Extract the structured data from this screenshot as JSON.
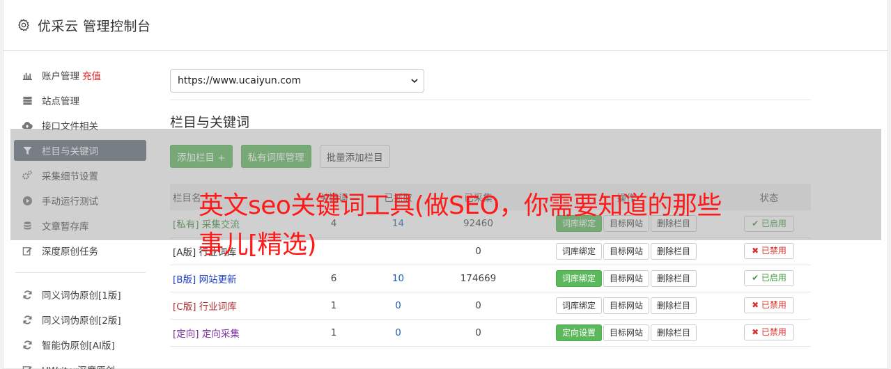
{
  "header": {
    "title": "优采云 管理控制台"
  },
  "sidebar": {
    "items": [
      {
        "label": "账户管理",
        "extra": "充值",
        "icon": "bar-chart-icon"
      },
      {
        "label": "站点管理",
        "icon": "server-icon"
      },
      {
        "label": "接口文件相关",
        "icon": "cloud-upload-icon"
      },
      {
        "label": "栏目与关键词",
        "icon": "filter-icon",
        "active": true
      },
      {
        "label": "采集细节设置",
        "icon": "gears-icon"
      },
      {
        "label": "手动运行测试",
        "icon": "play-icon"
      },
      {
        "label": "文章暂存库",
        "icon": "database-icon"
      },
      {
        "label": "深度原创任务",
        "icon": "edit-icon"
      }
    ],
    "items2": [
      {
        "label": "同义词伪原创[1版]",
        "icon": "refresh-icon"
      },
      {
        "label": "同义词伪原创[2版]",
        "icon": "refresh-icon"
      },
      {
        "label": "智能伪原创[AI版]",
        "icon": "refresh-icon"
      },
      {
        "label": "UWriter深度原创",
        "icon": "edit-icon"
      }
    ]
  },
  "main": {
    "site_select": "https://www.ucaiyun.com",
    "section_title": "栏目与关键词",
    "buttons": {
      "add_column": "添加栏目 +",
      "private_lib": "私有词库管理",
      "batch_add": "批量添加栏目"
    },
    "table": {
      "headers": [
        "栏目名",
        "关键词",
        "已抓取",
        "已采集",
        "操作",
        "状态"
      ],
      "header_col1_visible": "栏目名",
      "rows": [
        {
          "tag": "[私有]",
          "name": "采集交流",
          "color": "#3c8a3c",
          "keywords": "4",
          "fetched": "14",
          "collected": "92460",
          "op1": "词库绑定",
          "op1_green": true,
          "op2": "目标网站",
          "op3": "删除栏目",
          "status": "已启用",
          "on": true
        },
        {
          "tag": "[A版]",
          "name": "行业词库",
          "color": "#333333",
          "keywords": "",
          "fetched": "",
          "collected": "0",
          "op1": "词库绑定",
          "op1_green": false,
          "op2": "目标网站",
          "op3": "删除栏目",
          "status": "已禁用",
          "on": false
        },
        {
          "tag": "[B版]",
          "name": "网站更新",
          "color": "#1f3fc8",
          "keywords": "6",
          "fetched": "10",
          "collected": "174669",
          "op1": "词库绑定",
          "op1_green": true,
          "op2": "目标网站",
          "op3": "删除栏目",
          "status": "已启用",
          "on": true
        },
        {
          "tag": "[C版]",
          "name": "行业词库",
          "color": "#b03030",
          "keywords": "1",
          "fetched": "0",
          "collected": "0",
          "op1": "词库绑定",
          "op1_green": false,
          "op2": "目标网站",
          "op3": "删除栏目",
          "status": "已禁用",
          "on": false
        },
        {
          "tag": "[定向]",
          "name": "定向采集",
          "color": "#7a2fa0",
          "keywords": "1",
          "fetched": "0",
          "collected": "0",
          "op1": "定向设置",
          "op1_green": true,
          "op2": "目标网站",
          "op3": "删除栏目",
          "status": "已禁用",
          "on": false
        }
      ]
    }
  },
  "overlay": {
    "text": "英文seo关键词工具(做SEO，你需要知道的那些事儿[精选)"
  },
  "colors": {
    "accent": "#5cb85c",
    "active_nav": "#5d6a78",
    "danger": "#d9302c",
    "overlay_text": "#ff1a1a"
  }
}
